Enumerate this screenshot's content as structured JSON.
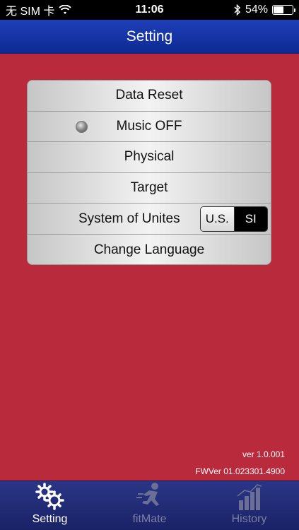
{
  "status_bar": {
    "carrier": "无 SIM 卡",
    "time": "11:06",
    "battery_percent": "54%",
    "battery_level": 0.54
  },
  "nav": {
    "title": "Setting"
  },
  "menu": {
    "items": [
      {
        "label": "Data Reset"
      },
      {
        "label": "Music OFF"
      },
      {
        "label": "Physical"
      },
      {
        "label": "Target"
      },
      {
        "label": "System of Unites",
        "options": [
          "U.S.",
          "SI"
        ],
        "selected": "SI"
      },
      {
        "label": "Change Language"
      }
    ]
  },
  "version": {
    "app": "ver 1.0.001",
    "fw": "FWVer 01.023301.4900"
  },
  "tabs": [
    {
      "label": "Setting",
      "icon": "gears-icon",
      "active": true
    },
    {
      "label": "fitMate",
      "icon": "runner-icon",
      "active": false
    },
    {
      "label": "History",
      "icon": "bar-chart-icon",
      "active": false
    }
  ],
  "colors": {
    "nav_blue": "#1f3fb8",
    "background_red": "#b92a3c",
    "tab_bar": "#1a2266"
  }
}
